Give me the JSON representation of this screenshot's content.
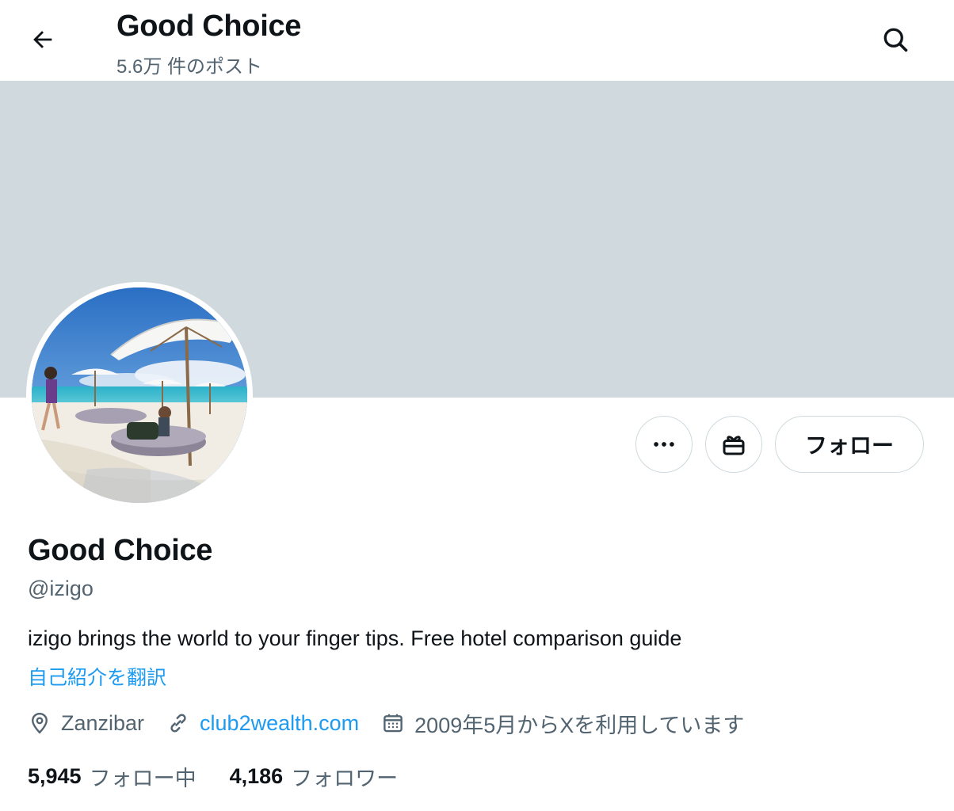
{
  "header": {
    "title": "Good Choice",
    "post_count": "5.6万 件のポスト"
  },
  "profile": {
    "display_name": "Good Choice",
    "handle": "@izigo",
    "bio": "izigo brings the world to your finger tips. Free hotel comparison guide",
    "translate_label": "自己紹介を翻訳",
    "location": "Zanzibar",
    "website": "club2wealth.com",
    "joined": "2009年5月からXを利用しています"
  },
  "actions": {
    "follow_label": "フォロー"
  },
  "counts": {
    "following_num": "5,945",
    "following_label": "フォロー中",
    "followers_num": "4,186",
    "followers_label": "フォロワー"
  },
  "colors": {
    "banner": "#cfd9de",
    "link": "#1d9bf0",
    "secondary_text": "#536471",
    "primary_text": "#0f1419"
  },
  "icons": [
    "arrow-left-icon",
    "search-icon",
    "more-icon",
    "gift-icon",
    "location-icon",
    "link-icon",
    "calendar-icon"
  ]
}
